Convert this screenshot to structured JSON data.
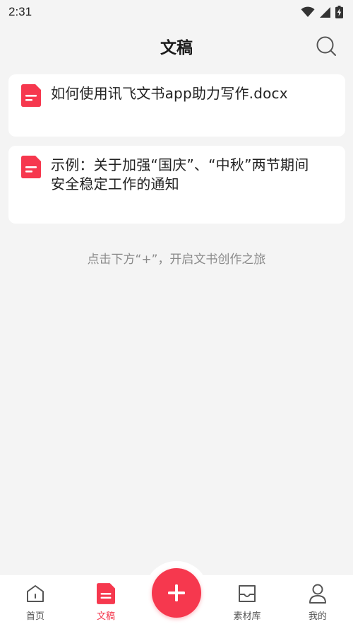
{
  "status": {
    "time": "2:31",
    "icons": [
      "wifi-icon",
      "cell-signal-icon",
      "battery-charging-icon"
    ]
  },
  "header": {
    "title": "文稿",
    "search_icon": "search-icon"
  },
  "documents": [
    {
      "title_line1": "如何使用讯飞文书app助力写作.docx",
      "title_line2": "",
      "icon": "document-icon"
    },
    {
      "title_line1": "示例：关于加强“国庆”、“中秋”两节期间",
      "title_line2": "安全稳定工作的通知",
      "icon": "document-icon"
    }
  ],
  "empty_hint": "点击下方“+”，开启文书创作之旅",
  "tabbar": {
    "items": [
      {
        "label": "首页",
        "icon": "home-icon",
        "active": false
      },
      {
        "label": "文稿",
        "icon": "document-icon",
        "active": true
      },
      {
        "label": "素材库",
        "icon": "inbox-icon",
        "active": false
      },
      {
        "label": "我的",
        "icon": "user-icon",
        "active": false
      }
    ],
    "fab_icon": "plus-icon"
  },
  "colors": {
    "accent": "#f6384e",
    "background": "#f4f4f4",
    "card": "#ffffff",
    "hint_text": "#8a8a8a"
  }
}
